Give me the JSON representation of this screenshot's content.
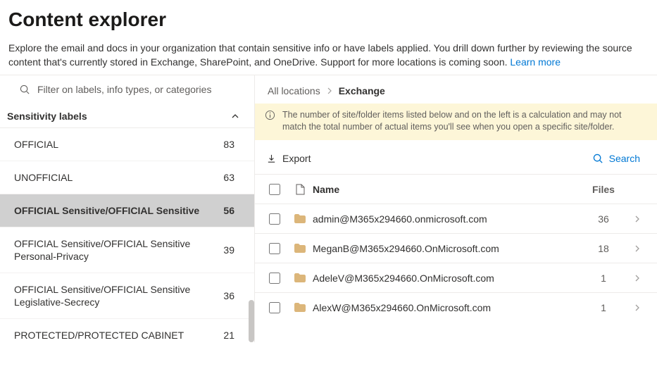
{
  "header": {
    "title": "Content explorer",
    "description_pre": "Explore the email and docs in your organization that contain sensitive info or have labels applied. You drill down further by reviewing the source content that's currently stored in Exchange, SharePoint, and OneDrive. Support for more locations is coming soon. ",
    "learn_more": "Learn more"
  },
  "sidebar": {
    "filter_placeholder": "Filter on labels, info types, or categories",
    "section_title": "Sensitivity labels",
    "items": [
      {
        "name": "OFFICIAL",
        "count": "83",
        "selected": false
      },
      {
        "name": "UNOFFICIAL",
        "count": "63",
        "selected": false
      },
      {
        "name": "OFFICIAL Sensitive/OFFICIAL Sensitive",
        "count": "56",
        "selected": true
      },
      {
        "name": "OFFICIAL Sensitive/OFFICIAL Sensitive Personal-Privacy",
        "count": "39",
        "selected": false
      },
      {
        "name": "OFFICIAL Sensitive/OFFICIAL Sensitive Legislative-Secrecy",
        "count": "36",
        "selected": false
      },
      {
        "name": "PROTECTED/PROTECTED CABINET",
        "count": "21",
        "selected": false
      }
    ]
  },
  "breadcrumb": {
    "root": "All locations",
    "current": "Exchange"
  },
  "banner": {
    "text": "The number of site/folder items listed below and on the left is a calculation and may not match the total number of actual items you'll see when you open a specific site/folder."
  },
  "toolbar": {
    "export_label": "Export",
    "search_label": "Search"
  },
  "table": {
    "headers": {
      "name": "Name",
      "files": "Files"
    },
    "rows": [
      {
        "name": "admin@M365x294660.onmicrosoft.com",
        "files": "36"
      },
      {
        "name": "MeganB@M365x294660.OnMicrosoft.com",
        "files": "18"
      },
      {
        "name": "AdeleV@M365x294660.OnMicrosoft.com",
        "files": "1"
      },
      {
        "name": "AlexW@M365x294660.OnMicrosoft.com",
        "files": "1"
      }
    ]
  }
}
